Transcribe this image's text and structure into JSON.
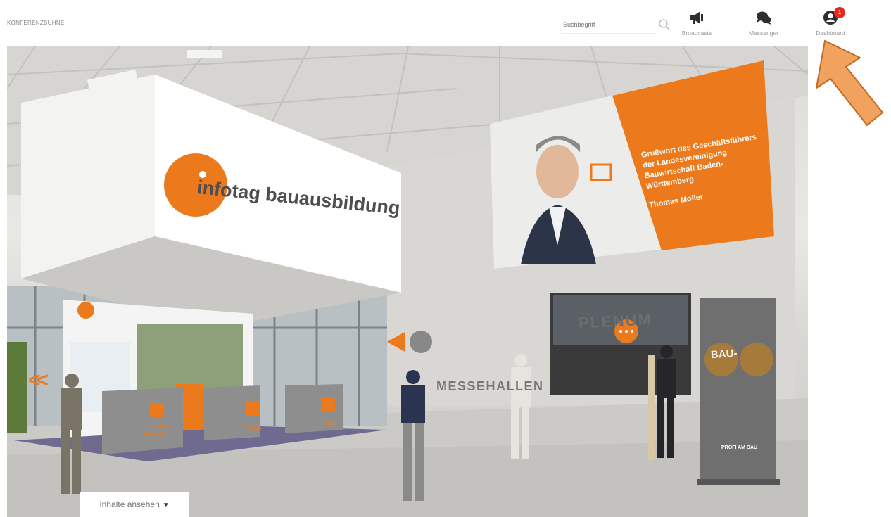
{
  "header": {
    "app_title": "KONFERENZBÜHNE",
    "search_placeholder": "Suchbegriff",
    "nav": [
      {
        "label": "Broadcasts",
        "icon": "megaphone-icon"
      },
      {
        "label": "Messenger",
        "icon": "chat-bubbles-icon"
      },
      {
        "label": "Dashboard",
        "icon": "user-circle-icon",
        "badge": "1"
      }
    ]
  },
  "scene": {
    "hanging_sign": "infotag bauausbildung",
    "screen": {
      "text": "Grußwort des Geschäftsführers der Landesvereinigung Bauwirtschaft Baden-Württemberg",
      "speaker": "Thomas Möller"
    },
    "plenum_label": "PLENUM",
    "messehallen_label": "MESSEHALLEN",
    "back_arrows": "<<",
    "kiosks": [
      {
        "label": "Inhalts-übersicht"
      },
      {
        "label": "Karte"
      },
      {
        "label": "Infos"
      }
    ],
    "rollup": {
      "title": "BAU-",
      "claim": "PROFI AM BAU"
    }
  },
  "footer": {
    "content_button": "Inhalte ansehen"
  },
  "colors": {
    "accent": "#ec7a1c",
    "badge": "#e42a1f",
    "pointer_arrow": "#f2a25f"
  }
}
